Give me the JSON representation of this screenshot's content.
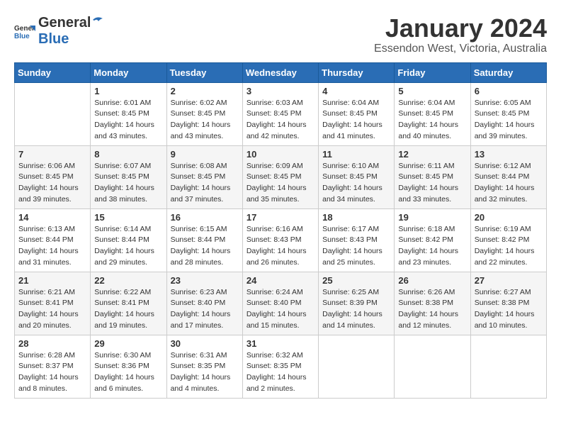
{
  "header": {
    "logo": {
      "general": "General",
      "blue": "Blue"
    },
    "title": "January 2024",
    "subtitle": "Essendon West, Victoria, Australia"
  },
  "calendar": {
    "weekdays": [
      "Sunday",
      "Monday",
      "Tuesday",
      "Wednesday",
      "Thursday",
      "Friday",
      "Saturday"
    ],
    "rows": [
      [
        {
          "day": "",
          "sunrise": "",
          "sunset": "",
          "daylight": ""
        },
        {
          "day": "1",
          "sunrise": "Sunrise: 6:01 AM",
          "sunset": "Sunset: 8:45 PM",
          "daylight": "Daylight: 14 hours and 43 minutes."
        },
        {
          "day": "2",
          "sunrise": "Sunrise: 6:02 AM",
          "sunset": "Sunset: 8:45 PM",
          "daylight": "Daylight: 14 hours and 43 minutes."
        },
        {
          "day": "3",
          "sunrise": "Sunrise: 6:03 AM",
          "sunset": "Sunset: 8:45 PM",
          "daylight": "Daylight: 14 hours and 42 minutes."
        },
        {
          "day": "4",
          "sunrise": "Sunrise: 6:04 AM",
          "sunset": "Sunset: 8:45 PM",
          "daylight": "Daylight: 14 hours and 41 minutes."
        },
        {
          "day": "5",
          "sunrise": "Sunrise: 6:04 AM",
          "sunset": "Sunset: 8:45 PM",
          "daylight": "Daylight: 14 hours and 40 minutes."
        },
        {
          "day": "6",
          "sunrise": "Sunrise: 6:05 AM",
          "sunset": "Sunset: 8:45 PM",
          "daylight": "Daylight: 14 hours and 39 minutes."
        }
      ],
      [
        {
          "day": "7",
          "sunrise": "Sunrise: 6:06 AM",
          "sunset": "Sunset: 8:45 PM",
          "daylight": "Daylight: 14 hours and 39 minutes."
        },
        {
          "day": "8",
          "sunrise": "Sunrise: 6:07 AM",
          "sunset": "Sunset: 8:45 PM",
          "daylight": "Daylight: 14 hours and 38 minutes."
        },
        {
          "day": "9",
          "sunrise": "Sunrise: 6:08 AM",
          "sunset": "Sunset: 8:45 PM",
          "daylight": "Daylight: 14 hours and 37 minutes."
        },
        {
          "day": "10",
          "sunrise": "Sunrise: 6:09 AM",
          "sunset": "Sunset: 8:45 PM",
          "daylight": "Daylight: 14 hours and 35 minutes."
        },
        {
          "day": "11",
          "sunrise": "Sunrise: 6:10 AM",
          "sunset": "Sunset: 8:45 PM",
          "daylight": "Daylight: 14 hours and 34 minutes."
        },
        {
          "day": "12",
          "sunrise": "Sunrise: 6:11 AM",
          "sunset": "Sunset: 8:45 PM",
          "daylight": "Daylight: 14 hours and 33 minutes."
        },
        {
          "day": "13",
          "sunrise": "Sunrise: 6:12 AM",
          "sunset": "Sunset: 8:44 PM",
          "daylight": "Daylight: 14 hours and 32 minutes."
        }
      ],
      [
        {
          "day": "14",
          "sunrise": "Sunrise: 6:13 AM",
          "sunset": "Sunset: 8:44 PM",
          "daylight": "Daylight: 14 hours and 31 minutes."
        },
        {
          "day": "15",
          "sunrise": "Sunrise: 6:14 AM",
          "sunset": "Sunset: 8:44 PM",
          "daylight": "Daylight: 14 hours and 29 minutes."
        },
        {
          "day": "16",
          "sunrise": "Sunrise: 6:15 AM",
          "sunset": "Sunset: 8:44 PM",
          "daylight": "Daylight: 14 hours and 28 minutes."
        },
        {
          "day": "17",
          "sunrise": "Sunrise: 6:16 AM",
          "sunset": "Sunset: 8:43 PM",
          "daylight": "Daylight: 14 hours and 26 minutes."
        },
        {
          "day": "18",
          "sunrise": "Sunrise: 6:17 AM",
          "sunset": "Sunset: 8:43 PM",
          "daylight": "Daylight: 14 hours and 25 minutes."
        },
        {
          "day": "19",
          "sunrise": "Sunrise: 6:18 AM",
          "sunset": "Sunset: 8:42 PM",
          "daylight": "Daylight: 14 hours and 23 minutes."
        },
        {
          "day": "20",
          "sunrise": "Sunrise: 6:19 AM",
          "sunset": "Sunset: 8:42 PM",
          "daylight": "Daylight: 14 hours and 22 minutes."
        }
      ],
      [
        {
          "day": "21",
          "sunrise": "Sunrise: 6:21 AM",
          "sunset": "Sunset: 8:41 PM",
          "daylight": "Daylight: 14 hours and 20 minutes."
        },
        {
          "day": "22",
          "sunrise": "Sunrise: 6:22 AM",
          "sunset": "Sunset: 8:41 PM",
          "daylight": "Daylight: 14 hours and 19 minutes."
        },
        {
          "day": "23",
          "sunrise": "Sunrise: 6:23 AM",
          "sunset": "Sunset: 8:40 PM",
          "daylight": "Daylight: 14 hours and 17 minutes."
        },
        {
          "day": "24",
          "sunrise": "Sunrise: 6:24 AM",
          "sunset": "Sunset: 8:40 PM",
          "daylight": "Daylight: 14 hours and 15 minutes."
        },
        {
          "day": "25",
          "sunrise": "Sunrise: 6:25 AM",
          "sunset": "Sunset: 8:39 PM",
          "daylight": "Daylight: 14 hours and 14 minutes."
        },
        {
          "day": "26",
          "sunrise": "Sunrise: 6:26 AM",
          "sunset": "Sunset: 8:38 PM",
          "daylight": "Daylight: 14 hours and 12 minutes."
        },
        {
          "day": "27",
          "sunrise": "Sunrise: 6:27 AM",
          "sunset": "Sunset: 8:38 PM",
          "daylight": "Daylight: 14 hours and 10 minutes."
        }
      ],
      [
        {
          "day": "28",
          "sunrise": "Sunrise: 6:28 AM",
          "sunset": "Sunset: 8:37 PM",
          "daylight": "Daylight: 14 hours and 8 minutes."
        },
        {
          "day": "29",
          "sunrise": "Sunrise: 6:30 AM",
          "sunset": "Sunset: 8:36 PM",
          "daylight": "Daylight: 14 hours and 6 minutes."
        },
        {
          "day": "30",
          "sunrise": "Sunrise: 6:31 AM",
          "sunset": "Sunset: 8:35 PM",
          "daylight": "Daylight: 14 hours and 4 minutes."
        },
        {
          "day": "31",
          "sunrise": "Sunrise: 6:32 AM",
          "sunset": "Sunset: 8:35 PM",
          "daylight": "Daylight: 14 hours and 2 minutes."
        },
        {
          "day": "",
          "sunrise": "",
          "sunset": "",
          "daylight": ""
        },
        {
          "day": "",
          "sunrise": "",
          "sunset": "",
          "daylight": ""
        },
        {
          "day": "",
          "sunrise": "",
          "sunset": "",
          "daylight": ""
        }
      ]
    ]
  }
}
